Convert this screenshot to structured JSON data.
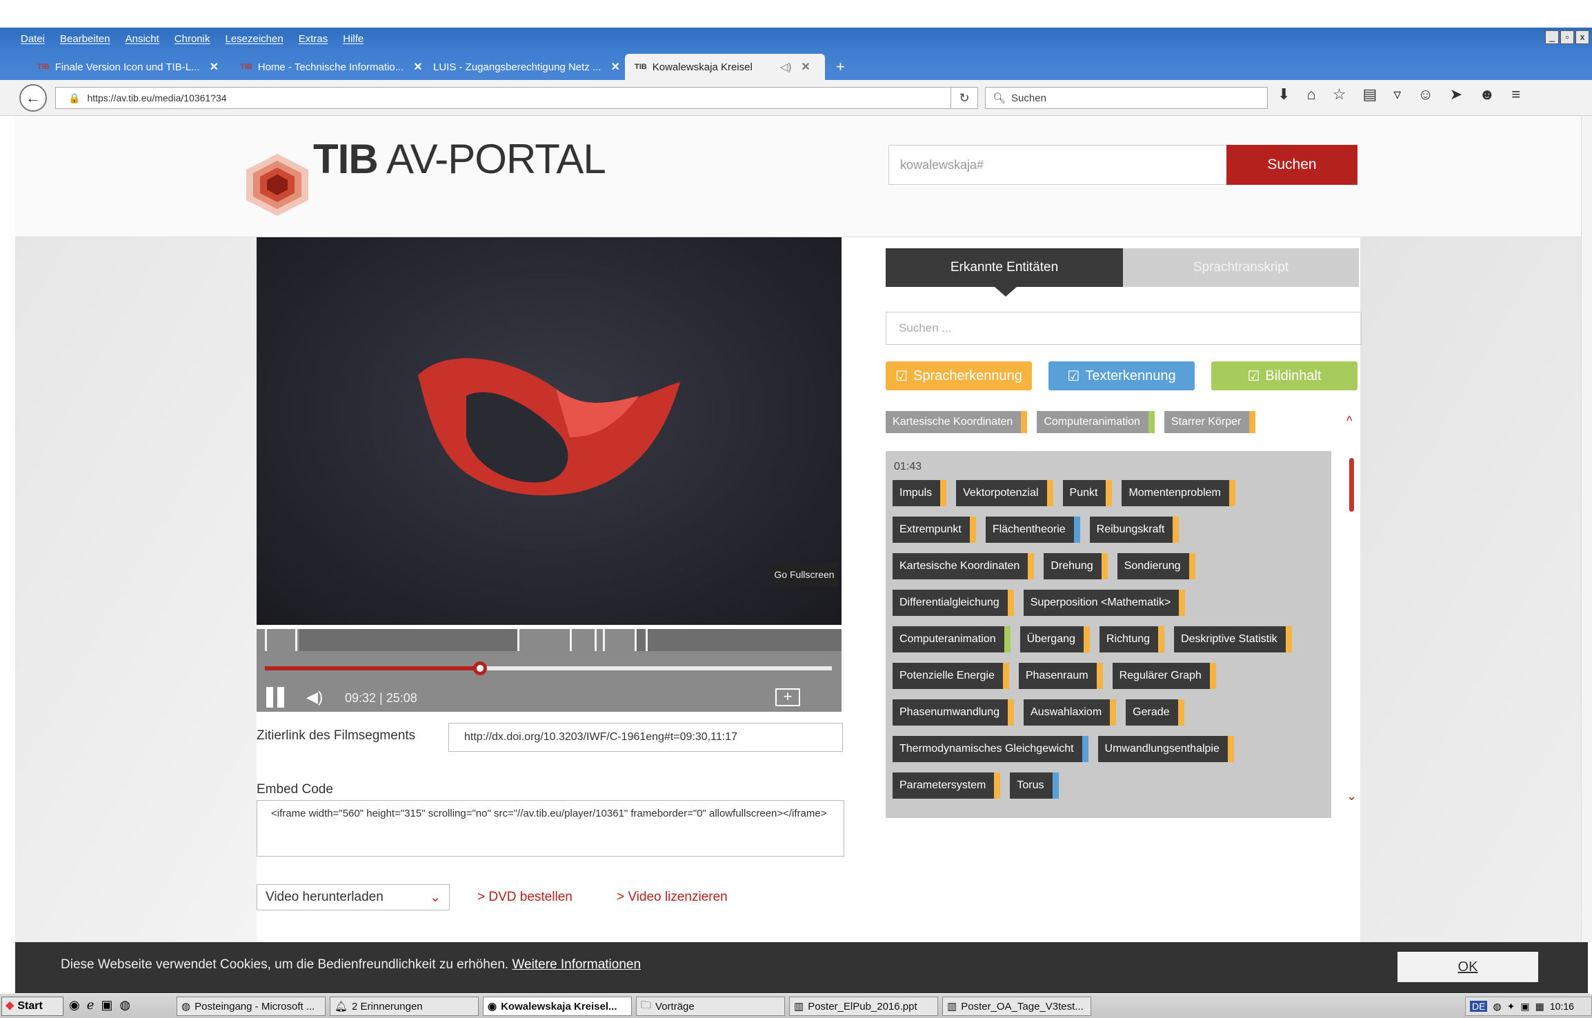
{
  "menubar": {
    "items": [
      "Datei",
      "Bearbeiten",
      "Ansicht",
      "Chronik",
      "Lesezeichen",
      "Extras",
      "Hilfe"
    ]
  },
  "tabs": [
    {
      "favicon": "TIB",
      "label": "Finale Version Icon und TIB-L..."
    },
    {
      "favicon": "TIB",
      "label": "Home - Technische Informatio..."
    },
    {
      "favicon": "",
      "label": "LUIS - Zugangsberechtigung Netz ..."
    },
    {
      "favicon": "TIB",
      "label": "Kowalewskaja Kreisel"
    }
  ],
  "urlbar": {
    "url": "https://av.tib.eu/media/10361?34",
    "search_placeholder": "Suchen"
  },
  "site": {
    "logo_bold": "TIB",
    "logo_rest": "AV-PORTAL",
    "search_value": "kowalewskaja#",
    "search_button": "Suchen"
  },
  "video": {
    "fullscreen_label": "Go Fullscreen",
    "time_readout": "09:32 | 25:08",
    "progress_fraction": 0.379
  },
  "citation": {
    "label": "Zitierlink des Filmsegments",
    "value": "http://dx.doi.org/10.3203/IWF/C-1961eng#t=09:30,11:17"
  },
  "embed": {
    "label": "Embed Code",
    "value": "<iframe width=\"560\" height=\"315\" scrolling=\"no\" src=\"//av.tib.eu/player/10361\" frameborder=\"0\" allowfullscreen></iframe>"
  },
  "actions": {
    "download_label": "Video herunterladen",
    "dvd_label": "> DVD bestellen",
    "license_label": "> Video lizenzieren"
  },
  "panel": {
    "tab_entities": "Erkannte Entitäten",
    "tab_transcript": "Sprachtranskript",
    "search_placeholder": "Suchen ...",
    "filters": {
      "speech": "Spracherkennung",
      "text": "Texterkennung",
      "image": "Bildinhalt"
    },
    "summary_tags": [
      {
        "label": "Kartesische Koordinaten",
        "color": "#f6b33f"
      },
      {
        "label": "Computeranimation",
        "color": "#a8cc5c"
      },
      {
        "label": "Starrer Körper",
        "color": "#f6b33f"
      }
    ],
    "timestamp": "01:43",
    "entity_tags": [
      {
        "label": "Impuls",
        "color": "#f6b33f"
      },
      {
        "label": "Vektorpotenzial",
        "color": "#f6b33f"
      },
      {
        "label": "Punkt",
        "color": "#f6b33f"
      },
      {
        "label": "Momentenproblem",
        "color": "#f6b33f"
      },
      {
        "label": "Extrempunkt",
        "color": "#f6b33f"
      },
      {
        "label": "Flächentheorie",
        "color": "#5aa0d8"
      },
      {
        "label": "Reibungskraft",
        "color": "#f6b33f"
      },
      {
        "label": "Kartesische Koordinaten",
        "color": "#f6b33f"
      },
      {
        "label": "Drehung",
        "color": "#f6b33f"
      },
      {
        "label": "Sondierung",
        "color": "#f6b33f"
      },
      {
        "label": "Differentialgleichung",
        "color": "#f6b33f"
      },
      {
        "label": "Superposition <Mathematik>",
        "color": "#f6b33f"
      },
      {
        "label": "Computeranimation",
        "color": "#a8cc5c"
      },
      {
        "label": "Übergang",
        "color": "#f6b33f"
      },
      {
        "label": "Richtung",
        "color": "#f6b33f"
      },
      {
        "label": "Deskriptive Statistik",
        "color": "#f6b33f"
      },
      {
        "label": "Potenzielle Energie",
        "color": "#f6b33f"
      },
      {
        "label": "Phasenraum",
        "color": "#f6b33f"
      },
      {
        "label": "Regulärer Graph",
        "color": "#f6b33f"
      },
      {
        "label": "Phasenumwandlung",
        "color": "#f6b33f"
      },
      {
        "label": "Auswahlaxiom",
        "color": "#f6b33f"
      },
      {
        "label": "Gerade",
        "color": "#f6b33f"
      },
      {
        "label": "Thermodynamisches Gleichgewicht",
        "color": "#5aa0d8"
      },
      {
        "label": "Umwandlungsenthalpie",
        "color": "#f6b33f"
      },
      {
        "label": "Parametersystem",
        "color": "#f6b33f"
      },
      {
        "label": "Torus",
        "color": "#5aa0d8"
      }
    ]
  },
  "cookie": {
    "text": "Diese Webseite verwendet Cookies, um die Bedienfreundlichkeit zu erhöhen.",
    "link": "Weitere Informationen",
    "ok": "OK"
  },
  "taskbar": {
    "start": "Start",
    "tasks": [
      "Posteingang - Microsoft ...",
      "2 Erinnerungen",
      "Kowalewskaja Kreisel...",
      "Vorträge",
      "Poster_ElPub_2016.ppt",
      "Poster_OA_Tage_V3test..."
    ],
    "lang": "DE",
    "clock": "10:16"
  }
}
